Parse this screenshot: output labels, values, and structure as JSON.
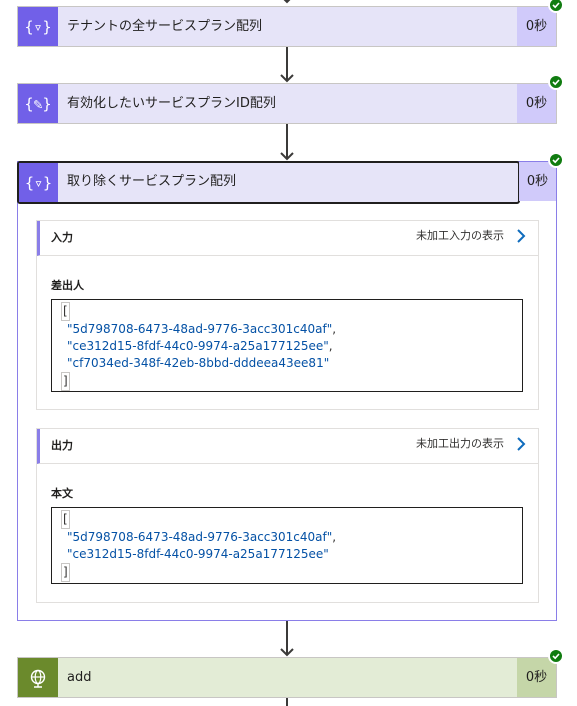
{
  "steps": [
    {
      "title": "テナントの全サービスプラン配列",
      "duration": "0秒",
      "icon": "variable-filter-icon",
      "icon_glyph": "{▿}",
      "status": "succeeded"
    },
    {
      "title": "有効化したいサービスプランID配列",
      "duration": "0秒",
      "icon": "variable-edit-icon",
      "icon_glyph": "{✎}",
      "status": "succeeded"
    }
  ],
  "expanded_step": {
    "title": "取り除くサービスプラン配列",
    "duration": "0秒",
    "icon": "variable-filter-icon",
    "icon_glyph": "{▿}",
    "status": "succeeded",
    "input": {
      "header": "入力",
      "raw_link": "未加工入力の表示",
      "field_label": "差出人",
      "open_bracket": "[",
      "close_bracket": "]",
      "items": [
        "\"5d798708-6473-48ad-9776-3acc301c40af\"",
        "\"ce312d15-8fdf-44c0-9974-a25a177125ee\"",
        "\"cf7034ed-348f-42eb-8bbd-dddeea43ee81\""
      ]
    },
    "output": {
      "header": "出力",
      "raw_link": "未加工出力の表示",
      "field_label": "本文",
      "open_bracket": "[",
      "close_bracket": "]",
      "items": [
        "\"5d798708-6473-48ad-9776-3acc301c40af\"",
        "\"ce312d15-8fdf-44c0-9974-a25a177125ee\""
      ]
    }
  },
  "add_step": {
    "title": "add",
    "duration": "0秒",
    "icon": "globe-icon",
    "status": "succeeded"
  },
  "colors": {
    "variable_accent": "#7160e8",
    "variable_bg": "#e6e4f8",
    "http_accent": "#6b8a2c",
    "http_bg": "#e3ecd6",
    "success": "#107c10",
    "json_string": "#0451a5"
  }
}
